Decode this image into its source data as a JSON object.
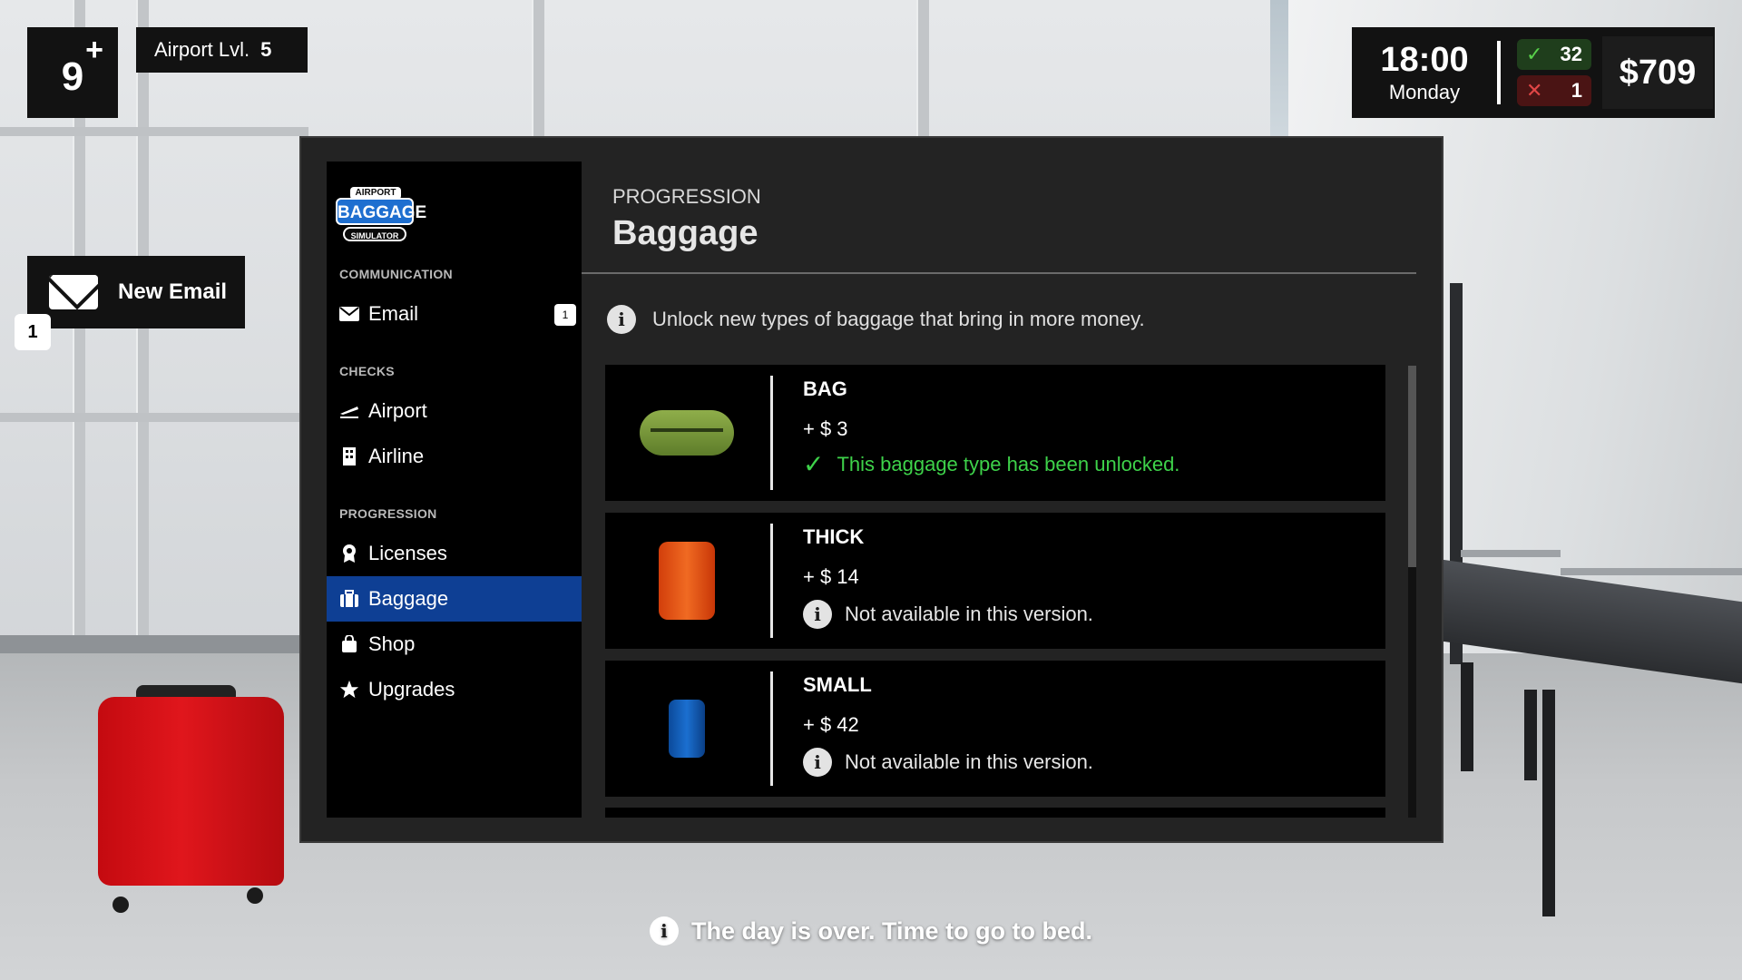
{
  "hud": {
    "level": "9",
    "level_plus": "+",
    "airport_label": "Airport Lvl.",
    "airport_level": "5",
    "time": "18:00",
    "day": "Monday",
    "checks_ok": "32",
    "checks_failed": "1",
    "money": "$709"
  },
  "toast": {
    "label": "New Email",
    "badge": "1"
  },
  "logo": {
    "top": "AIRPORT",
    "mid": "BAGGAGE",
    "bottom": "SIMULATOR"
  },
  "sidebar": {
    "sections": [
      {
        "label": "COMMUNICATION"
      },
      {
        "label": "CHECKS"
      },
      {
        "label": "PROGRESSION"
      }
    ],
    "items": [
      {
        "label": "Email",
        "icon": "envelope-icon",
        "badge": "1"
      },
      {
        "label": "Airport",
        "icon": "plane-icon"
      },
      {
        "label": "Airline",
        "icon": "building-icon"
      },
      {
        "label": "Licenses",
        "icon": "award-icon"
      },
      {
        "label": "Baggage",
        "icon": "luggage-icon",
        "active": true
      },
      {
        "label": "Shop",
        "icon": "bag-icon"
      },
      {
        "label": "Upgrades",
        "icon": "star-icon"
      }
    ]
  },
  "content": {
    "eyebrow": "PROGRESSION",
    "title": "Baggage",
    "info": "Unlock new types of baggage that bring in more money.",
    "cards": [
      {
        "name": "BAG",
        "price": "+ $ 3",
        "status": "This baggage type has been unlocked.",
        "unlocked": true
      },
      {
        "name": "THICK",
        "price": "+ $ 14",
        "status": "Not available in this version.",
        "unlocked": false
      },
      {
        "name": "SMALL",
        "price": "+ $ 42",
        "status": "Not available in this version.",
        "unlocked": false
      }
    ]
  },
  "footer": {
    "message": "The day is over. Time to go to bed."
  },
  "colors": {
    "accent": "#0e3f94",
    "success": "#3ed24a",
    "danger": "#e24646"
  }
}
